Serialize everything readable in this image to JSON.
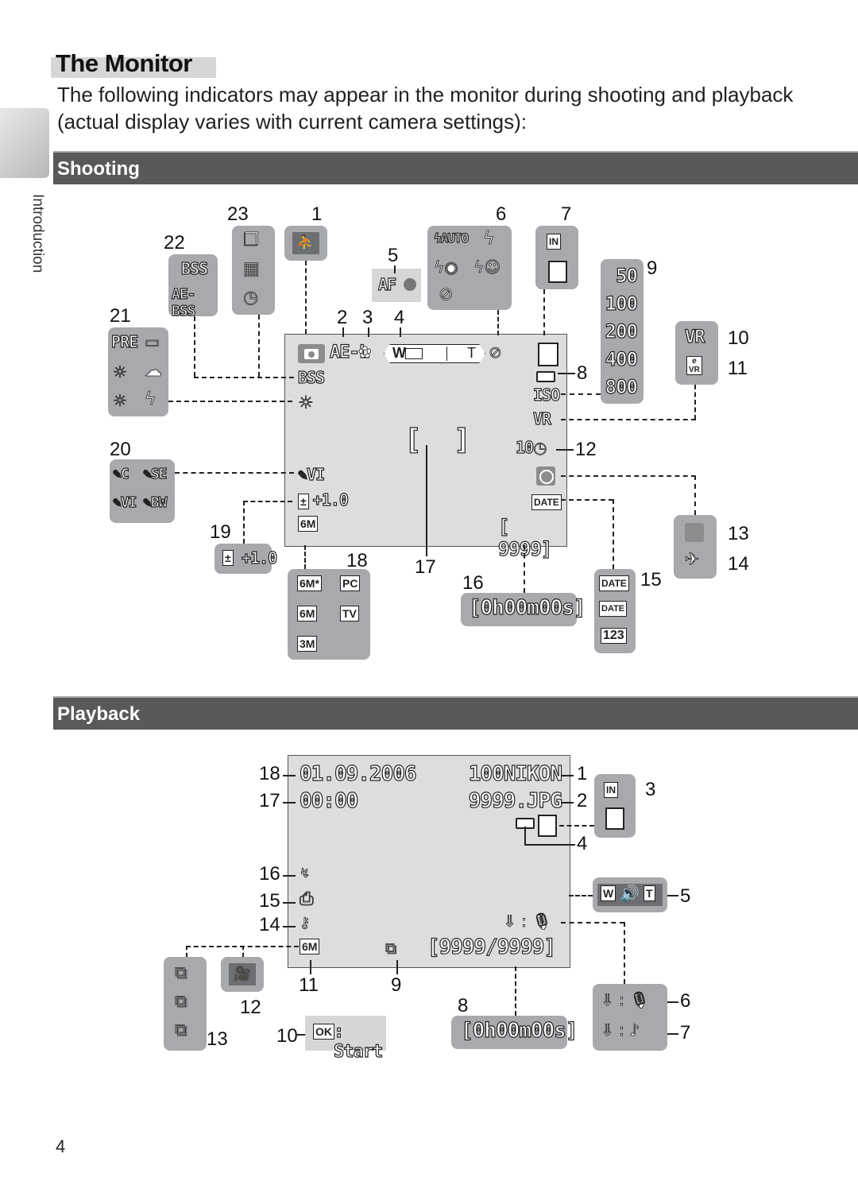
{
  "page": {
    "title": "The Monitor",
    "intro_line1": "The following indicators may appear in the monitor during shooting and playback",
    "intro_line2": "(actual display varies with current camera settings):",
    "side_tab": "Introduction",
    "page_number": "4"
  },
  "shooting": {
    "heading": "Shooting",
    "screen": {
      "ael": "AE-L",
      "zoom_w": "W",
      "zoom_t": "T",
      "bss": "BSS",
      "iso": "ISO",
      "vr": "VR",
      "self_timer": "10",
      "date": "DATE",
      "exposures": "[ 9999]",
      "color_option": "VI",
      "exp_comp": "+1.0",
      "image_mode": "6M"
    },
    "callouts": {
      "n1": "1",
      "n2": "2",
      "n3": "3",
      "n4": "4",
      "n5": "5",
      "n6": "6",
      "n7": "7",
      "n8": "8",
      "n9": "9",
      "n10": "10",
      "n11": "11",
      "n12": "12",
      "n13": "13",
      "n14": "14",
      "n15": "15",
      "n16": "16",
      "n17": "17",
      "n18": "18",
      "n19": "19",
      "n20": "20",
      "n21": "21",
      "n22": "22",
      "n23": "23"
    },
    "af_label": "AF",
    "flash_panel": {
      "auto": "AUTO"
    },
    "memory_panel": {
      "internal": "IN"
    },
    "iso_values": [
      "50",
      "100",
      "200",
      "400",
      "800"
    ],
    "vr_panel": {
      "vr": "VR",
      "evr": "VR",
      "evr_e": "e"
    },
    "date_panel": [
      "DATE",
      "DATE",
      "123"
    ],
    "time_panel": {
      "movie_time": "[0h00m00s]"
    },
    "exp_panel": "+1.0",
    "color_panel": [
      "C",
      "SE",
      "VI",
      "BW"
    ],
    "wb_panel": {
      "pre": "PRE"
    },
    "bss_panel": [
      "BSS",
      "AE-BSS"
    ],
    "image_mode_panel": [
      "6M*",
      "PC",
      "6M",
      "TV",
      "3M"
    ]
  },
  "playback": {
    "heading": "Playback",
    "screen": {
      "date": "01.09.2006",
      "time": "00:00",
      "folder": "100NIKON",
      "file": "9999.JPG",
      "frame_count": "[9999/9999]",
      "image_mode": "6M"
    },
    "callouts": {
      "n1": "1",
      "n2": "2",
      "n3": "3",
      "n4": "4",
      "n5": "5",
      "n6": "6",
      "n7": "7",
      "n8": "8",
      "n9": "9",
      "n10": "10",
      "n11": "11",
      "n12": "12",
      "n13": "13",
      "n14": "14",
      "n15": "15",
      "n16": "16",
      "n17": "17",
      "n18": "18"
    },
    "memory_panel": {
      "internal": "IN"
    },
    "volume_panel": {
      "w": "W",
      "t": "T"
    },
    "movie_time": "[0h00m00s]",
    "ok_start": {
      "ok": "OK",
      "label": ": Start"
    }
  }
}
